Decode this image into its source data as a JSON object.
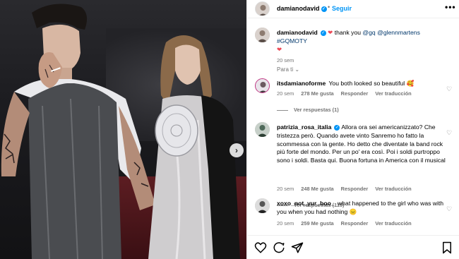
{
  "post": {
    "username": "damianodavid",
    "follow_label": "Seguir",
    "more_label": "•••",
    "separator": "•"
  },
  "caption": {
    "username": "damianodavid",
    "text_pre": "thank you ",
    "mentions": "@gq @glennmartens #GQMOTY",
    "time": "20 sem"
  },
  "sort_label": "Para ti ⌄",
  "comments": [
    {
      "username": "itsdamianoforme",
      "text": "You both looked so beautiful 🥰",
      "time": "20 sem",
      "likes": "278 Me gusta",
      "reply": "Responder",
      "translate": "Ver traducción",
      "view_replies": "Ver respuestas (1)"
    },
    {
      "username": "patrizia_rosa_italia",
      "text": "Allora ora sei americanizzato? Che tristezza però. Quando avete vinto Sanremo ho fatto la scommessa con la gente. Ho detto che diventate la band rock più forte del mondo. Per un po' era così. Poi i soldi purtroppo sono i soldi. Basta qui. Buona fortuna in America con il musical",
      "time": "20 sem",
      "likes": "248 Me gusta",
      "reply": "Responder",
      "translate": "Ver traducción",
      "view_replies": "Ver respuestas (115)"
    },
    {
      "username": "xoxo_not_yur_boo_",
      "text": "what happened to the girl who was with you when you had nothing 😑",
      "time": "20 sem",
      "likes": "259 Me gusta",
      "reply": "Responder",
      "translate": "Ver traducción"
    }
  ],
  "colors": {
    "accent": "#0095f6",
    "heart": "#ed4956",
    "muted": "#737373"
  },
  "icons": [
    "heart-icon",
    "comment-icon",
    "share-icon",
    "bookmark-icon"
  ]
}
